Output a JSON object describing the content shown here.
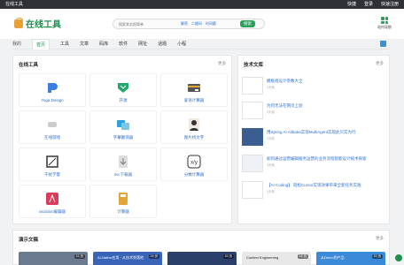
{
  "topbar": {
    "site": "在线工具",
    "links": [
      "快捷",
      "登录",
      "快速注册"
    ]
  },
  "header": {
    "logo": "在线工具",
    "search_placeholder": "搜索其实很简单",
    "hot_links": [
      "解密",
      "二维码",
      "时间戳"
    ],
    "search_button": "搜索",
    "site_nav": "站内导航"
  },
  "nav": {
    "mine": "我的",
    "items": [
      "首页",
      "工具",
      "文章",
      "码库",
      "软件",
      "网址",
      "话题",
      "小程"
    ]
  },
  "tools": {
    "title": "在线工具",
    "more": "更多",
    "items": [
      {
        "label": "Yoga Design",
        "icon": "yoga-design-icon",
        "color": "#3b7de0"
      },
      {
        "label": "开源",
        "icon": "open-source-icon",
        "color": "#21a86b"
      },
      {
        "label": "爱语计算器",
        "icon": "calculator-card-icon",
        "color": "#555"
      },
      {
        "label": "在线游戏",
        "icon": "game-icon",
        "color": "#ccc"
      },
      {
        "label": "字幕翻译器",
        "icon": "translate-icon",
        "color": "#2ea3d8"
      },
      {
        "label": "图片找文字",
        "icon": "portrait-icon",
        "color": "#333"
      },
      {
        "label": "干扰学量",
        "icon": "frame-icon",
        "color": "#333"
      },
      {
        "label": "svc下载器",
        "icon": "download-icon",
        "color": "#777"
      },
      {
        "label": "分数计算器",
        "icon": "xy-icon",
        "color": "#333"
      },
      {
        "label": "asciidoc编辑器",
        "icon": "asciidoc-icon",
        "color": "#d93d5a"
      },
      {
        "label": "计算器",
        "icon": "calc-icon",
        "color": "#e3a53a"
      }
    ]
  },
  "blog": {
    "title": "技术文库",
    "more": "更多",
    "posts": [
      {
        "title": "模板组设计参数大全",
        "date": "2天前"
      },
      {
        "title": "为何无法在网页上验",
        "date": "2天前"
      },
      {
        "title": "用Spring AI Alibaba实现MultiAgent实现此只实为行",
        "date": "3天前"
      },
      {
        "title": "如何通过运营编辑服务运营的业务流程智能设计技术探索",
        "date": "3天前"
      },
      {
        "title": "【AI Coding】 轻松Cursor实现效果带来全新任务实践",
        "date": "3天前"
      }
    ]
  },
  "demo": {
    "title": "演示文稿",
    "more": "更多",
    "cards": [
      {
        "count": "22 页",
        "color": "#6b7a8f",
        "text": ""
      },
      {
        "count": "24 页",
        "color": "#3a64b8",
        "text": "AI-Native应用 · 从技术到落地"
      },
      {
        "count": "20 页",
        "color": "#2b3f6b",
        "text": ""
      },
      {
        "count": "24 页",
        "color": "#e8e8e8",
        "text": "Context Engineering"
      },
      {
        "count": "20 页",
        "color": "#3b8ad8",
        "text": "从Demo到产品"
      }
    ]
  }
}
